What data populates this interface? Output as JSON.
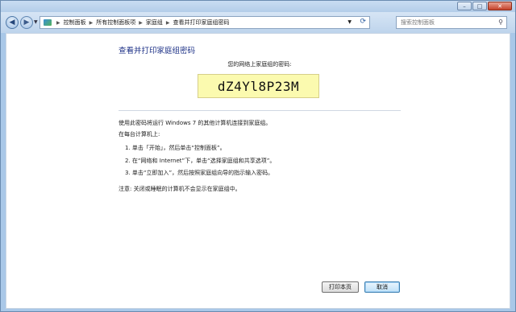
{
  "window": {
    "controls": {
      "minimize": "–",
      "maximize": "□",
      "close": "✕"
    }
  },
  "nav": {
    "back_icon": "arrow-left-icon",
    "forward_icon": "arrow-right-icon",
    "breadcrumb": [
      "控制面板",
      "所有控制面板项",
      "家庭组",
      "查看并打印家庭组密码"
    ],
    "search_placeholder": "搜索控制面板"
  },
  "main": {
    "heading": "查看并打印家庭组密码",
    "password_label": "您的网络上家庭组的密码:",
    "password": "dZ4Yl8P23M",
    "intro": "使用此密码将运行 Windows 7 的其他计算机连接到家庭组。",
    "on_each": "在每台计算机上:",
    "steps": [
      "1.  单击「开始」，然后单击“控制面板”。",
      "2.  在“网络和 Internet”下，单击“选择家庭组和共享选项”。",
      "3.  单击“立即加入”，然后按照家庭组向导的指示输入密码。"
    ],
    "note": "注意: 关闭或睡眠的计算机不会显示在家庭组中。"
  },
  "buttons": {
    "print": "打印本页",
    "cancel": "取消"
  },
  "colors": {
    "heading": "#1e3287",
    "password_bg": "#fbfaaf"
  }
}
